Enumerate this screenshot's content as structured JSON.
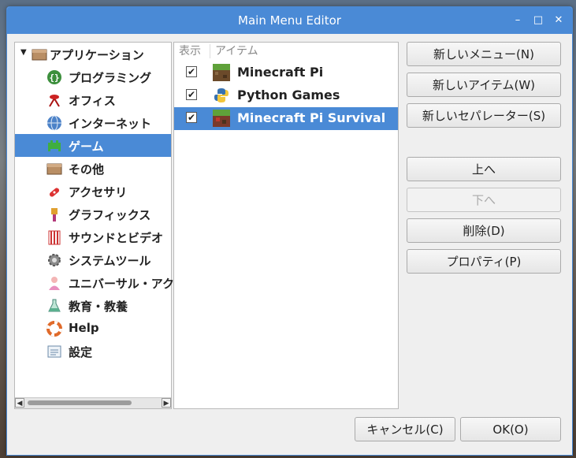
{
  "window": {
    "title": "Main Menu Editor",
    "controls": {
      "minimize": "–",
      "maximize": "□",
      "close": "✕"
    }
  },
  "tree": {
    "root_label": "アプリケーション",
    "items": [
      {
        "label": "プログラミング",
        "icon": "programming-icon"
      },
      {
        "label": "オフィス",
        "icon": "office-icon"
      },
      {
        "label": "インターネット",
        "icon": "internet-icon"
      },
      {
        "label": "ゲーム",
        "icon": "games-icon",
        "selected": true
      },
      {
        "label": "その他",
        "icon": "other-icon"
      },
      {
        "label": "アクセサリ",
        "icon": "accessories-icon"
      },
      {
        "label": "グラフィックス",
        "icon": "graphics-icon"
      },
      {
        "label": "サウンドとビデオ",
        "icon": "sound-video-icon"
      },
      {
        "label": "システムツール",
        "icon": "system-tools-icon"
      },
      {
        "label": "ユニバーサル・アク",
        "icon": "universal-access-icon"
      },
      {
        "label": "教育・教養",
        "icon": "education-icon"
      },
      {
        "label": "Help",
        "icon": "help-icon"
      },
      {
        "label": "設定",
        "icon": "settings-icon"
      }
    ]
  },
  "items_panel": {
    "col_show": "表示",
    "col_item": "アイテム",
    "rows": [
      {
        "label": "Minecraft Pi",
        "checked": true,
        "icon": "minecraft-icon"
      },
      {
        "label": "Python Games",
        "checked": true,
        "icon": "python-icon"
      },
      {
        "label": "Minecraft Pi Survival",
        "checked": true,
        "icon": "minecraft-icon",
        "selected": true
      }
    ]
  },
  "buttons": {
    "new_menu": "新しいメニュー(N)",
    "new_item": "新しいアイテム(W)",
    "new_separator": "新しいセパレーター(S)",
    "move_up": "上へ",
    "move_down": "下へ",
    "delete": "削除(D)",
    "properties": "プロパティ(P)",
    "cancel": "キャンセル(C)",
    "ok": "OK(O)"
  },
  "colors": {
    "accent": "#4a8ad6"
  }
}
